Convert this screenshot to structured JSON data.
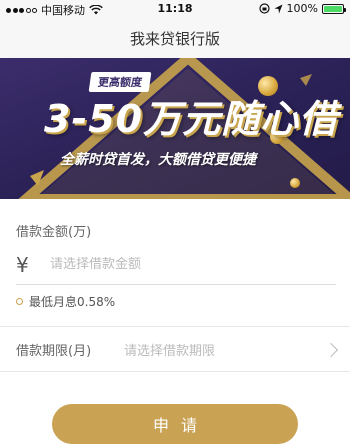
{
  "status_bar": {
    "carrier": "中国移动",
    "time": "11:18",
    "battery_percent": "100%",
    "battery_level": 1.0,
    "icons": [
      "signal-icon",
      "wifi-icon",
      "lock-rotation-icon",
      "location-icon",
      "battery-icon"
    ]
  },
  "nav": {
    "title": "我来贷银行版"
  },
  "banner": {
    "tag": "更高额度",
    "headline": "3-50万元随心借",
    "subline": "全薪时贷首发，大额借贷更便捷",
    "colors": {
      "background": "#2a2156",
      "triangle": "#c8a44c",
      "text_shadow": "#c8a44c"
    }
  },
  "form": {
    "amount_label": "借款金额(万)",
    "currency_symbol": "¥",
    "amount_placeholder": "请选择借款金额",
    "rate_text": "最低月息0.58%",
    "term_label": "借款期限(月)",
    "term_placeholder": "请选择借款期限"
  },
  "submit": {
    "label": "申请",
    "color": "#c9a253"
  }
}
